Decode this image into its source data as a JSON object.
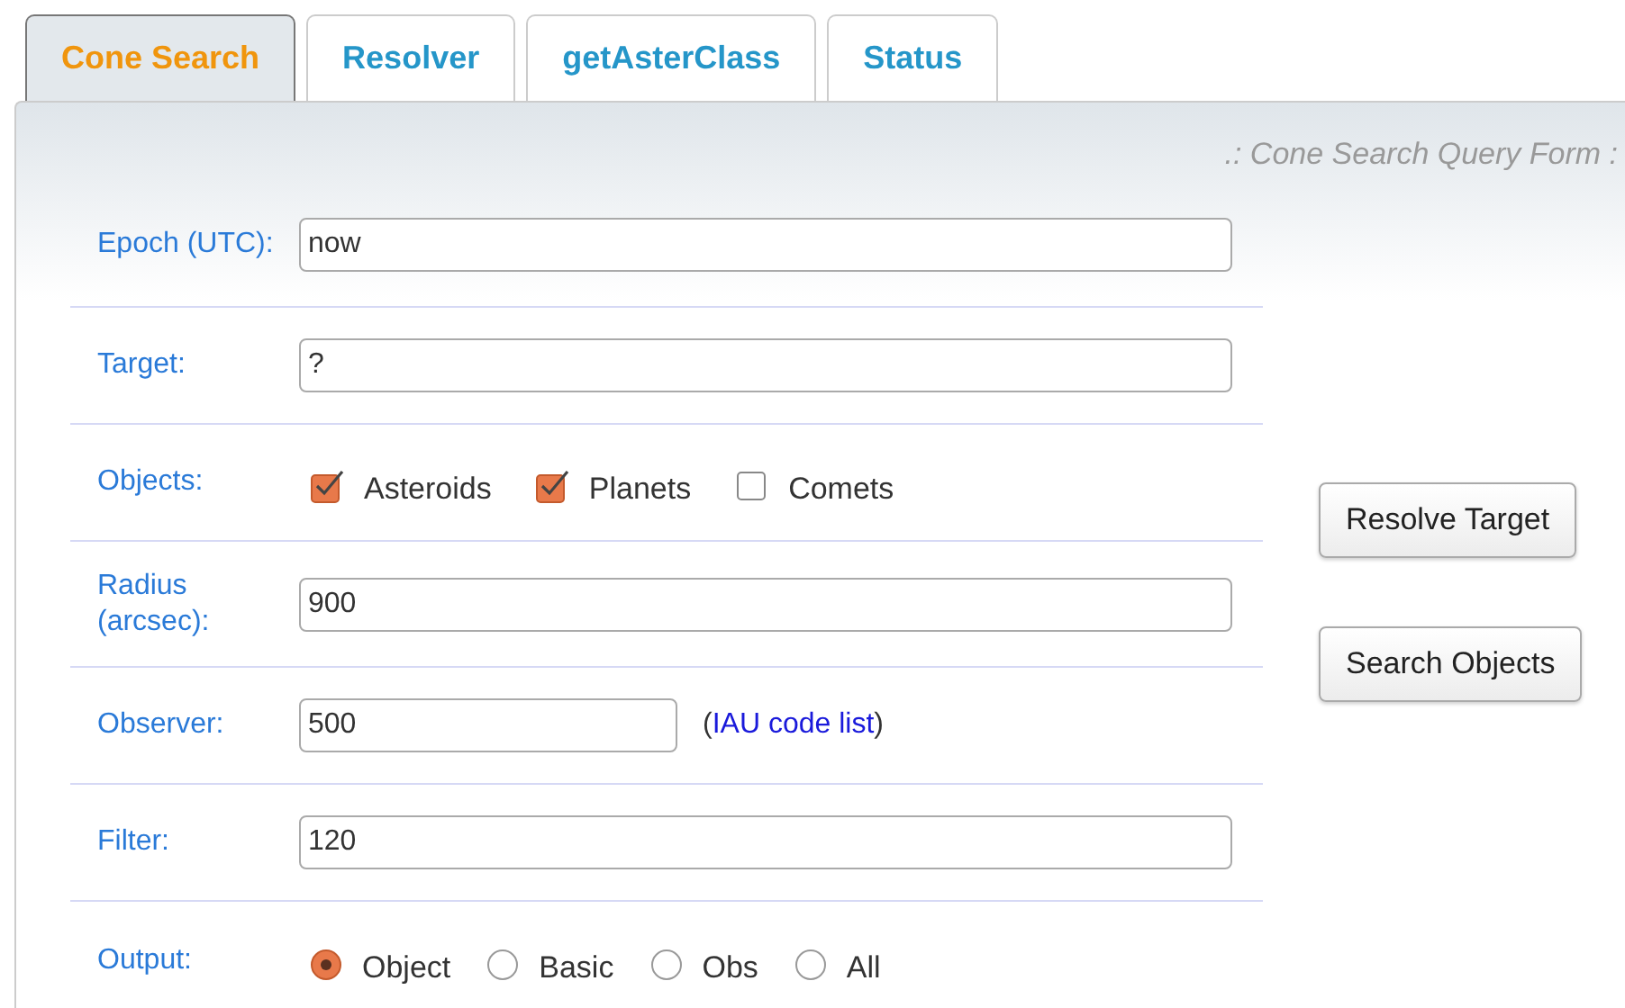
{
  "tabs": [
    {
      "label": "Cone Search",
      "selected": true
    },
    {
      "label": "Resolver",
      "selected": false
    },
    {
      "label": "getAsterClass",
      "selected": false
    },
    {
      "label": "Status",
      "selected": false
    }
  ],
  "form_title": ".: Cone Search Query Form :",
  "rows": [
    {
      "kind": "text",
      "label": "Epoch (UTC):",
      "value": "now"
    },
    {
      "kind": "text",
      "label": "Target:",
      "value": "?"
    },
    {
      "kind": "checkboxes",
      "label": "Objects:",
      "options": [
        {
          "label": "Asteroids",
          "checked": true
        },
        {
          "label": "Planets",
          "checked": true
        },
        {
          "label": "Comets",
          "checked": false
        }
      ]
    },
    {
      "kind": "text",
      "label": "Radius (arcsec):",
      "value": "900"
    },
    {
      "kind": "link",
      "label": "Observer:",
      "value": "500",
      "before": "(",
      "link": "IAU code list",
      "after": ")"
    },
    {
      "kind": "text",
      "label": "Filter:",
      "value": "120"
    },
    {
      "kind": "radios",
      "label": "Output:",
      "options": [
        {
          "label": "Object",
          "selected": true
        },
        {
          "label": "Basic",
          "selected": false
        },
        {
          "label": "Obs",
          "selected": false
        },
        {
          "label": "All",
          "selected": false
        }
      ]
    }
  ],
  "buttons": [
    "Resolve Target",
    "Search Objects"
  ]
}
